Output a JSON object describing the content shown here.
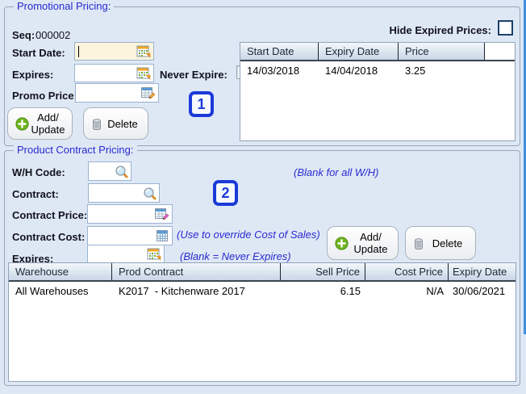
{
  "promo": {
    "title": "Promotional Pricing:",
    "seq_label": "Seq:",
    "seq_value": "000002",
    "start_date_label": "Start Date:",
    "expires_label": "Expires:",
    "never_expire_label": "Never Expire:",
    "promo_price_label": "Promo Price:",
    "add_update_line1": "Add/",
    "add_update_line2": "Update",
    "delete_label": "Delete",
    "marker": "1",
    "hide_expired_label": "Hide Expired Prices:",
    "table": {
      "columns": [
        "Start Date",
        "Expiry Date",
        "Price"
      ],
      "rows": [
        {
          "start": "14/03/2018",
          "expiry": "14/04/2018",
          "price": "3.25"
        }
      ]
    }
  },
  "contract": {
    "title": "Product Contract Pricing:",
    "wh_code_label": "W/H Code:",
    "wh_hint": "(Blank for all W/H)",
    "contract_label": "Contract:",
    "contract_price_label": "Contract Price:",
    "contract_cost_label": "Contract Cost:",
    "cost_hint": "(Use to override Cost of Sales)",
    "expires_label": "Expires:",
    "expires_hint": "(Blank = Never Expires)",
    "add_update_line1": "Add/",
    "add_update_line2": "Update",
    "delete_label": "Delete",
    "marker": "2",
    "table": {
      "columns": [
        "Warehouse",
        "Prod Contract",
        "Sell Price",
        "Cost Price",
        "Expiry Date"
      ],
      "rows": [
        {
          "warehouse": "All Warehouses",
          "prod_contract": "K2017  - Kitchenware 2017",
          "sell_price": "6.15",
          "cost_price": "N/A",
          "expiry": "30/06/2021"
        }
      ]
    }
  },
  "colors": {
    "page_bg": "#dee8f5",
    "group_title_blue": "#2a2ad0",
    "hint_blue": "#2a2ad2",
    "marker_blue": "#1b3ad8",
    "start_date_field_bg": "#fcf4dc",
    "navy_checkbox_border": "#1d4066",
    "window_edge_blue": "#4090e2"
  }
}
